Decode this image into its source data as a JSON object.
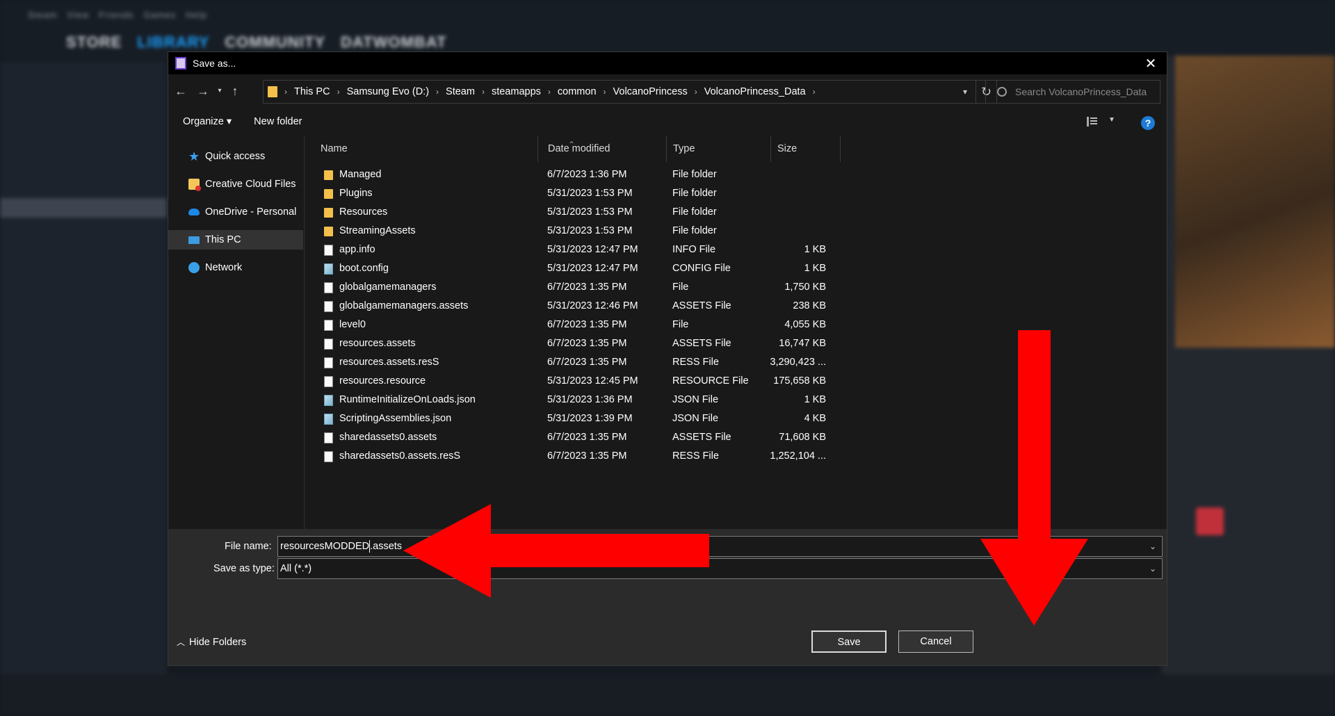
{
  "dialog": {
    "title": "Save as...",
    "close": "✕"
  },
  "address": {
    "crumbs": [
      "This PC",
      "Samsung Evo (D:)",
      "Steam",
      "steamapps",
      "common",
      "VolcanoPrincess",
      "VolcanoPrincess_Data"
    ],
    "search_placeholder": "Search VolcanoPrincess_Data"
  },
  "toolbar": {
    "organize": "Organize ▾",
    "new_folder": "New folder",
    "help": "?"
  },
  "nav": {
    "items": [
      {
        "label": "Quick access",
        "icon": "star-icon"
      },
      {
        "label": "Creative Cloud Files",
        "icon": "creative-cloud-folder-icon"
      },
      {
        "label": "OneDrive - Personal",
        "icon": "onedrive-icon"
      },
      {
        "label": "This PC",
        "icon": "computer-icon"
      },
      {
        "label": "Network",
        "icon": "network-icon"
      }
    ]
  },
  "columns": {
    "name": "Name",
    "date": "Date modified",
    "type": "Type",
    "size": "Size"
  },
  "files": [
    {
      "name": "Managed",
      "date": "6/7/2023 1:36 PM",
      "type": "File folder",
      "size": "",
      "icon": "folder"
    },
    {
      "name": "Plugins",
      "date": "5/31/2023 1:53 PM",
      "type": "File folder",
      "size": "",
      "icon": "folder"
    },
    {
      "name": "Resources",
      "date": "5/31/2023 1:53 PM",
      "type": "File folder",
      "size": "",
      "icon": "folder"
    },
    {
      "name": "StreamingAssets",
      "date": "5/31/2023 1:53 PM",
      "type": "File folder",
      "size": "",
      "icon": "folder"
    },
    {
      "name": "app.info",
      "date": "5/31/2023 12:47 PM",
      "type": "INFO File",
      "size": "1 KB",
      "icon": "file"
    },
    {
      "name": "boot.config",
      "date": "5/31/2023 12:47 PM",
      "type": "CONFIG File",
      "size": "1 KB",
      "icon": "cfg"
    },
    {
      "name": "globalgamemanagers",
      "date": "6/7/2023 1:35 PM",
      "type": "File",
      "size": "1,750 KB",
      "icon": "file"
    },
    {
      "name": "globalgamemanagers.assets",
      "date": "5/31/2023 12:46 PM",
      "type": "ASSETS File",
      "size": "238 KB",
      "icon": "file"
    },
    {
      "name": "level0",
      "date": "6/7/2023 1:35 PM",
      "type": "File",
      "size": "4,055 KB",
      "icon": "file"
    },
    {
      "name": "resources.assets",
      "date": "6/7/2023 1:35 PM",
      "type": "ASSETS File",
      "size": "16,747 KB",
      "icon": "file"
    },
    {
      "name": "resources.assets.resS",
      "date": "6/7/2023 1:35 PM",
      "type": "RESS File",
      "size": "3,290,423 ...",
      "icon": "file"
    },
    {
      "name": "resources.resource",
      "date": "5/31/2023 12:45 PM",
      "type": "RESOURCE File",
      "size": "175,658 KB",
      "icon": "file"
    },
    {
      "name": "RuntimeInitializeOnLoads.json",
      "date": "5/31/2023 1:36 PM",
      "type": "JSON File",
      "size": "1 KB",
      "icon": "cfg"
    },
    {
      "name": "ScriptingAssemblies.json",
      "date": "5/31/2023 1:39 PM",
      "type": "JSON File",
      "size": "4 KB",
      "icon": "cfg"
    },
    {
      "name": "sharedassets0.assets",
      "date": "6/7/2023 1:35 PM",
      "type": "ASSETS File",
      "size": "71,608 KB",
      "icon": "file"
    },
    {
      "name": "sharedassets0.assets.resS",
      "date": "6/7/2023 1:35 PM",
      "type": "RESS File",
      "size": "1,252,104 ...",
      "icon": "file"
    }
  ],
  "form": {
    "filename_label": "File name:",
    "filename_before_caret": "resourcesMODDED",
    "filename_after_caret": ".assets",
    "type_label": "Save as type:",
    "type_value": "All (*.*)"
  },
  "footer": {
    "hide_folders": "Hide Folders",
    "save": "Save",
    "cancel": "Cancel"
  },
  "colors": {
    "annotation_arrow": "#ff0000",
    "accent": "#1e7bd6"
  }
}
